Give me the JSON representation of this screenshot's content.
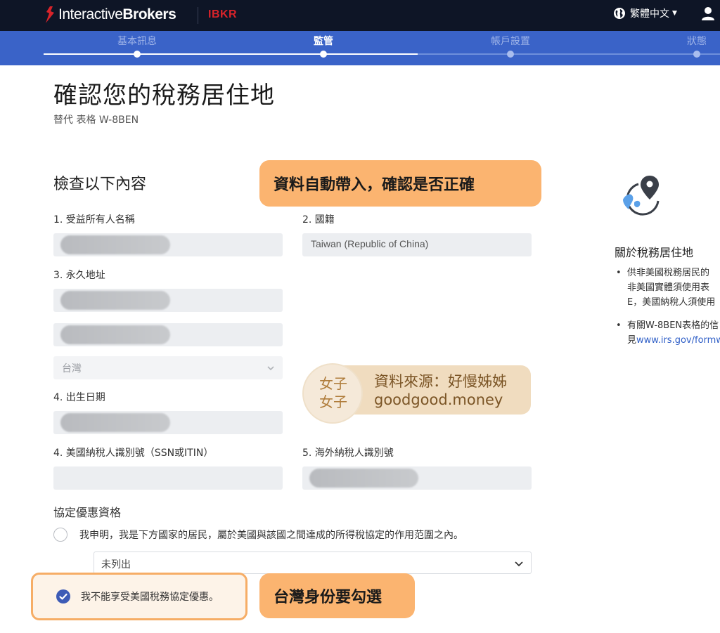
{
  "header": {
    "logo_text_regular": "Interactive",
    "logo_text_bold": "Brokers",
    "ibkr": "IBKR",
    "language": "繁體中文"
  },
  "steps": [
    {
      "label": "基本訊息",
      "active": false
    },
    {
      "label": "監管",
      "active": true
    },
    {
      "label": "帳戶設置",
      "active": false
    },
    {
      "label": "狀態",
      "active": false
    }
  ],
  "page": {
    "title": "確認您的稅務居住地",
    "subtitle": "替代 表格 W-8BEN"
  },
  "form": {
    "section_title": "檢查以下內容",
    "fields": {
      "beneficial_owner_label": "1. 受益所有人名稱",
      "nationality_label": "2. 國籍",
      "nationality_value": "Taiwan (Republic of China)",
      "permanent_address_label": "3. 永久地址",
      "country_value": "台灣",
      "dob_label": "4. 出生日期",
      "us_tin_label": "4. 美國納稅人識別號（SSN或ITIN）",
      "foreign_tin_label": "5. 海外納稅人識別號"
    },
    "treaty": {
      "title": "協定優惠資格",
      "option_claim": "我申明，我是下方國家的居民，屬於美國與該國之間達成的所得稅協定的作用范圍之內。",
      "country_select": "未列出",
      "option_no_benefit": "我不能享受美國稅務協定優惠。",
      "option_no_benefit_checked": true
    }
  },
  "annotations": {
    "auto_fill": "資料自動帶入，確認是否正確",
    "taiwan_check": "台灣身份要勾選"
  },
  "watermark": {
    "logo": "女子\n女子",
    "logo_line1": "女子",
    "logo_line2": "女子",
    "source": "資料來源：好慢姊姊",
    "site": "goodgood.money"
  },
  "sidebar": {
    "title": "關於稅務居住地",
    "items": [
      {
        "lines": [
          "供非美國稅務居民的",
          "非美國實體須使用表",
          "E，美國納稅人須使用"
        ]
      },
      {
        "text": "有關W-8BEN表格的信",
        "prefix": "見",
        "link": "www.irs.gov/formw"
      }
    ]
  },
  "colors": {
    "nav_bg": "#0e1526",
    "step_bg": "#3a63c8",
    "brand_red": "#d8232a",
    "callout_orange": "#fbb470",
    "check_blue": "#3d5bb6",
    "link_blue": "#2f5fc7"
  },
  "icons": {
    "language": "globe-icon",
    "user": "user-icon",
    "sidebar": "globe-location-icon",
    "dropdown": "chevron-down-icon",
    "checked": "check-icon"
  }
}
